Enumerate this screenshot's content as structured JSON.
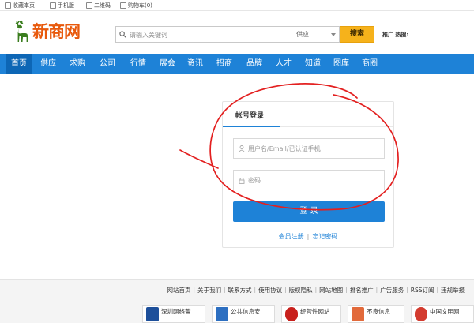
{
  "topbar": {
    "items": [
      {
        "label": "收藏本页",
        "icon": "bookmark-icon"
      },
      {
        "label": "手机版",
        "icon": "phone-icon"
      },
      {
        "label": "二维码",
        "icon": "qrcode-icon"
      },
      {
        "label": "购物车(0)",
        "icon": "cart-icon"
      }
    ]
  },
  "header": {
    "logo_text": "新商网",
    "search": {
      "placeholder": "请输入关键词",
      "category_selected": "供应",
      "button_label": "搜索"
    },
    "promo_label": "推广 热搜:"
  },
  "nav": {
    "items": [
      "首页",
      "供应",
      "求购",
      "公司",
      "行情",
      "展会",
      "资讯",
      "招商",
      "品牌",
      "人才",
      "知道",
      "图库",
      "商圈"
    ],
    "active_index": 0
  },
  "login": {
    "tab_label": "帐号登录",
    "username_placeholder": "用户名/Email/已认证手机",
    "password_placeholder": "密码",
    "submit_label": "登 录",
    "register_link": "会员注册",
    "forgot_link": "忘记密码",
    "divider": "|"
  },
  "footer": {
    "links": [
      "网站首页",
      "关于我们",
      "联系方式",
      "使用协议",
      "版权隐私",
      "网站地图",
      "排名推广",
      "广告服务",
      "RSS订阅",
      "违规举报"
    ],
    "separator": "|",
    "badges": [
      {
        "text": "深圳网络警",
        "icon": "police-badge-icon"
      },
      {
        "text": "公共信息安",
        "icon": "security-shield-icon"
      },
      {
        "text": "经营性网站",
        "icon": "emblem-icon"
      },
      {
        "text": "不良信息",
        "icon": "report-icon"
      },
      {
        "text": "中国文明网",
        "icon": "civilization-icon"
      }
    ]
  },
  "colors": {
    "brand_blue": "#1e82d7",
    "nav_active": "#0d66b5",
    "search_button": "#f6b21b",
    "logo_orange": "#e8590c",
    "annotation_red": "#e32020"
  }
}
